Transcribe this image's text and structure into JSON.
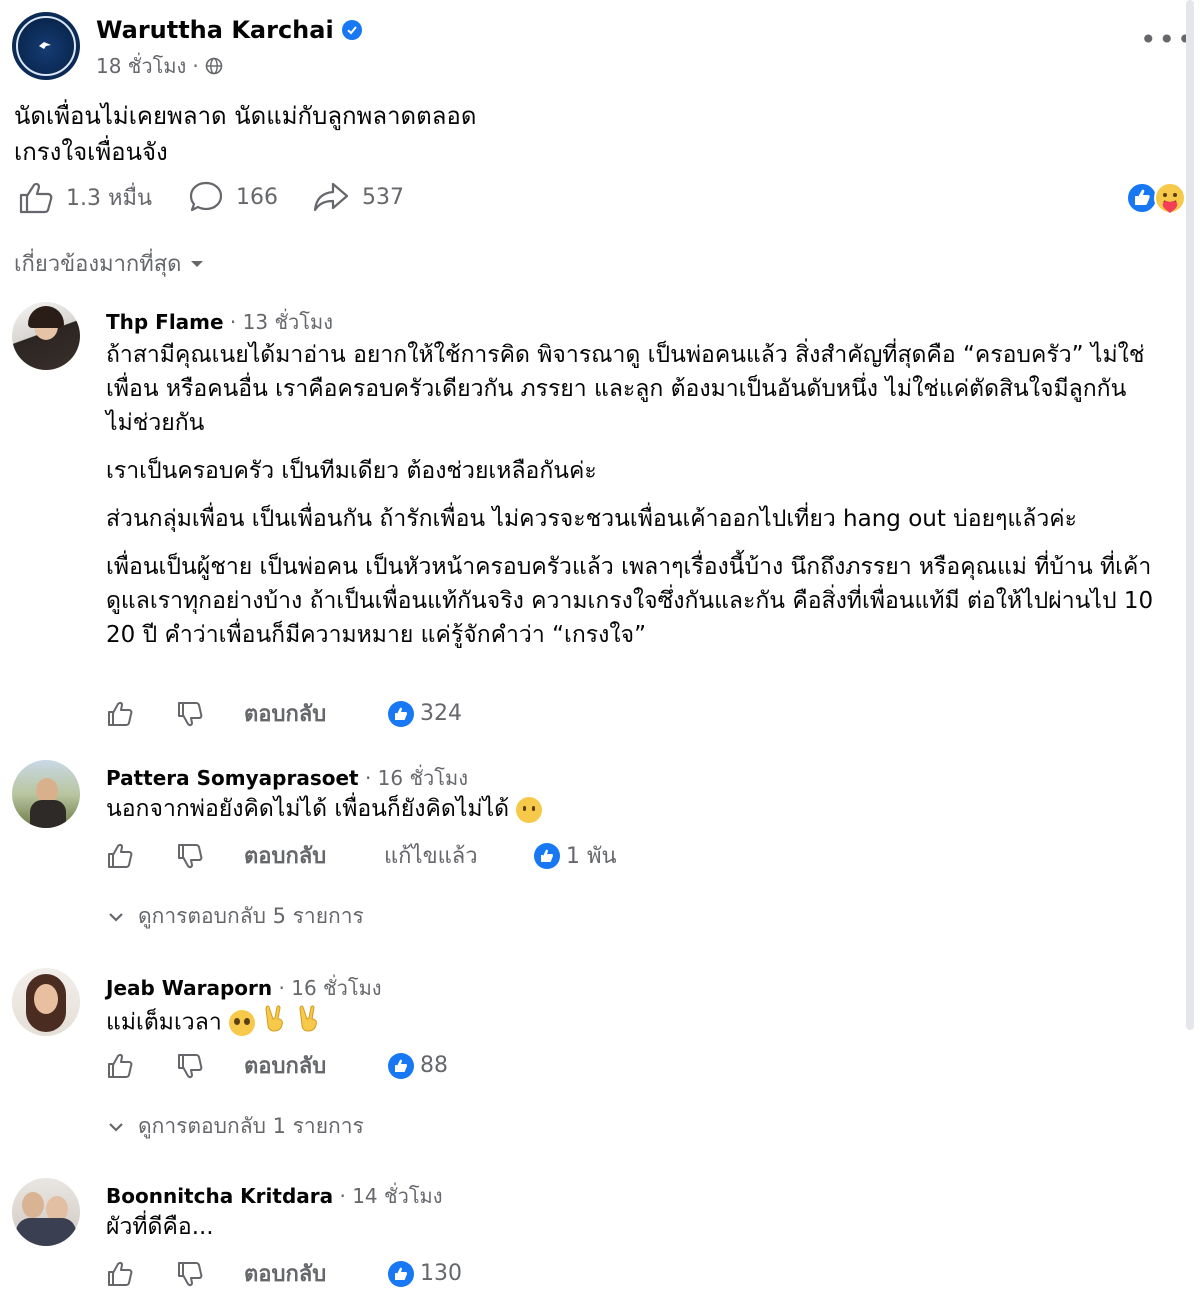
{
  "post": {
    "author": "Waruttha Karchai",
    "time": "18 ชั่วโมง",
    "text_line1": "นัดเพื่อนไม่เคยพลาด นัดแม่กับลูกพลาดตลอด",
    "text_line2": "เกรงใจเพื่อนจัง",
    "likes": "1.3 หมื่น",
    "comments": "166",
    "shares": "537",
    "more": "•••"
  },
  "sort_label": "เกี่ยวข้องมากที่สุด",
  "comments": [
    {
      "name": "Thp Flame",
      "time": "13 ชั่วโมง",
      "paragraphs": [
        "ถ้าสามีคุณเนยได้มาอ่าน อยากให้ใช้การคิด พิจารณาดู เป็นพ่อคนแล้ว สิ่งสำคัญที่สุดคือ “ครอบครัว” ไม่ใช่เพื่อน หรือคนอื่น เราคือครอบครัวเดียวกัน ภรรยา และลูก ต้องมาเป็นอันดับหนึ่ง ไม่ใช่แค่ตัดสินใจมีลูกกัน ไม่ช่วยกัน",
        "เราเป็นครอบครัว เป็นทีมเดียว ต้องช่วยเหลือกันค่ะ",
        "ส่วนกลุ่มเพื่อน เป็นเพื่อนกัน ถ้ารักเพื่อน ไม่ควรจะชวนเพื่อนเค้าออกไปเที่ยว hang out บ่อยๆแล้วค่ะ",
        "เพื่อนเป็นผู้ชาย เป็นพ่อคน เป็นหัวหน้าครอบครัวแล้ว เพลาๆเรื่องนี้บ้าง นึกถึงภรรยา หรือคุณแม่ ที่บ้าน ที่เค้าดูแลเราทุกอย่างบ้าง ถ้าเป็นเพื่อนแท้กันจริง ความเกรงใจซึ่งกันและกัน คือสิ่งที่เพื่อนแท้มี ต่อให้ไปผ่านไป 10 20 ปี คำว่าเพื่อนก็มีความหมาย แค่รู้จักคำว่า “เกรงใจ”"
      ],
      "reply": "ตอบกลับ",
      "likes": "324"
    },
    {
      "name": "Pattera Somyaprasoet",
      "time": "16 ชั่วโมง",
      "text": "นอกจากพ่อยังคิดไม่ได้ เพื่อนก็ยังคิดไม่ได้",
      "reply": "ตอบกลับ",
      "edited": "แก้ไขแล้ว",
      "likes": "1 พัน",
      "view_replies": "ดูการตอบกลับ 5 รายการ"
    },
    {
      "name": "Jeab Waraporn",
      "time": "16 ชั่วโมง",
      "text": "แม่เต็มเวลา",
      "reply": "ตอบกลับ",
      "likes": "88",
      "view_replies": "ดูการตอบกลับ 1 รายการ"
    },
    {
      "name": "Boonnitcha Kritdara",
      "time": "14 ชั่วโมง",
      "text": "ผัวที่ดีคือ...",
      "reply": "ตอบกลับ",
      "likes": "130"
    }
  ],
  "colors": {
    "accent": "#1877f2",
    "muted": "#65676b",
    "text": "#050505"
  }
}
